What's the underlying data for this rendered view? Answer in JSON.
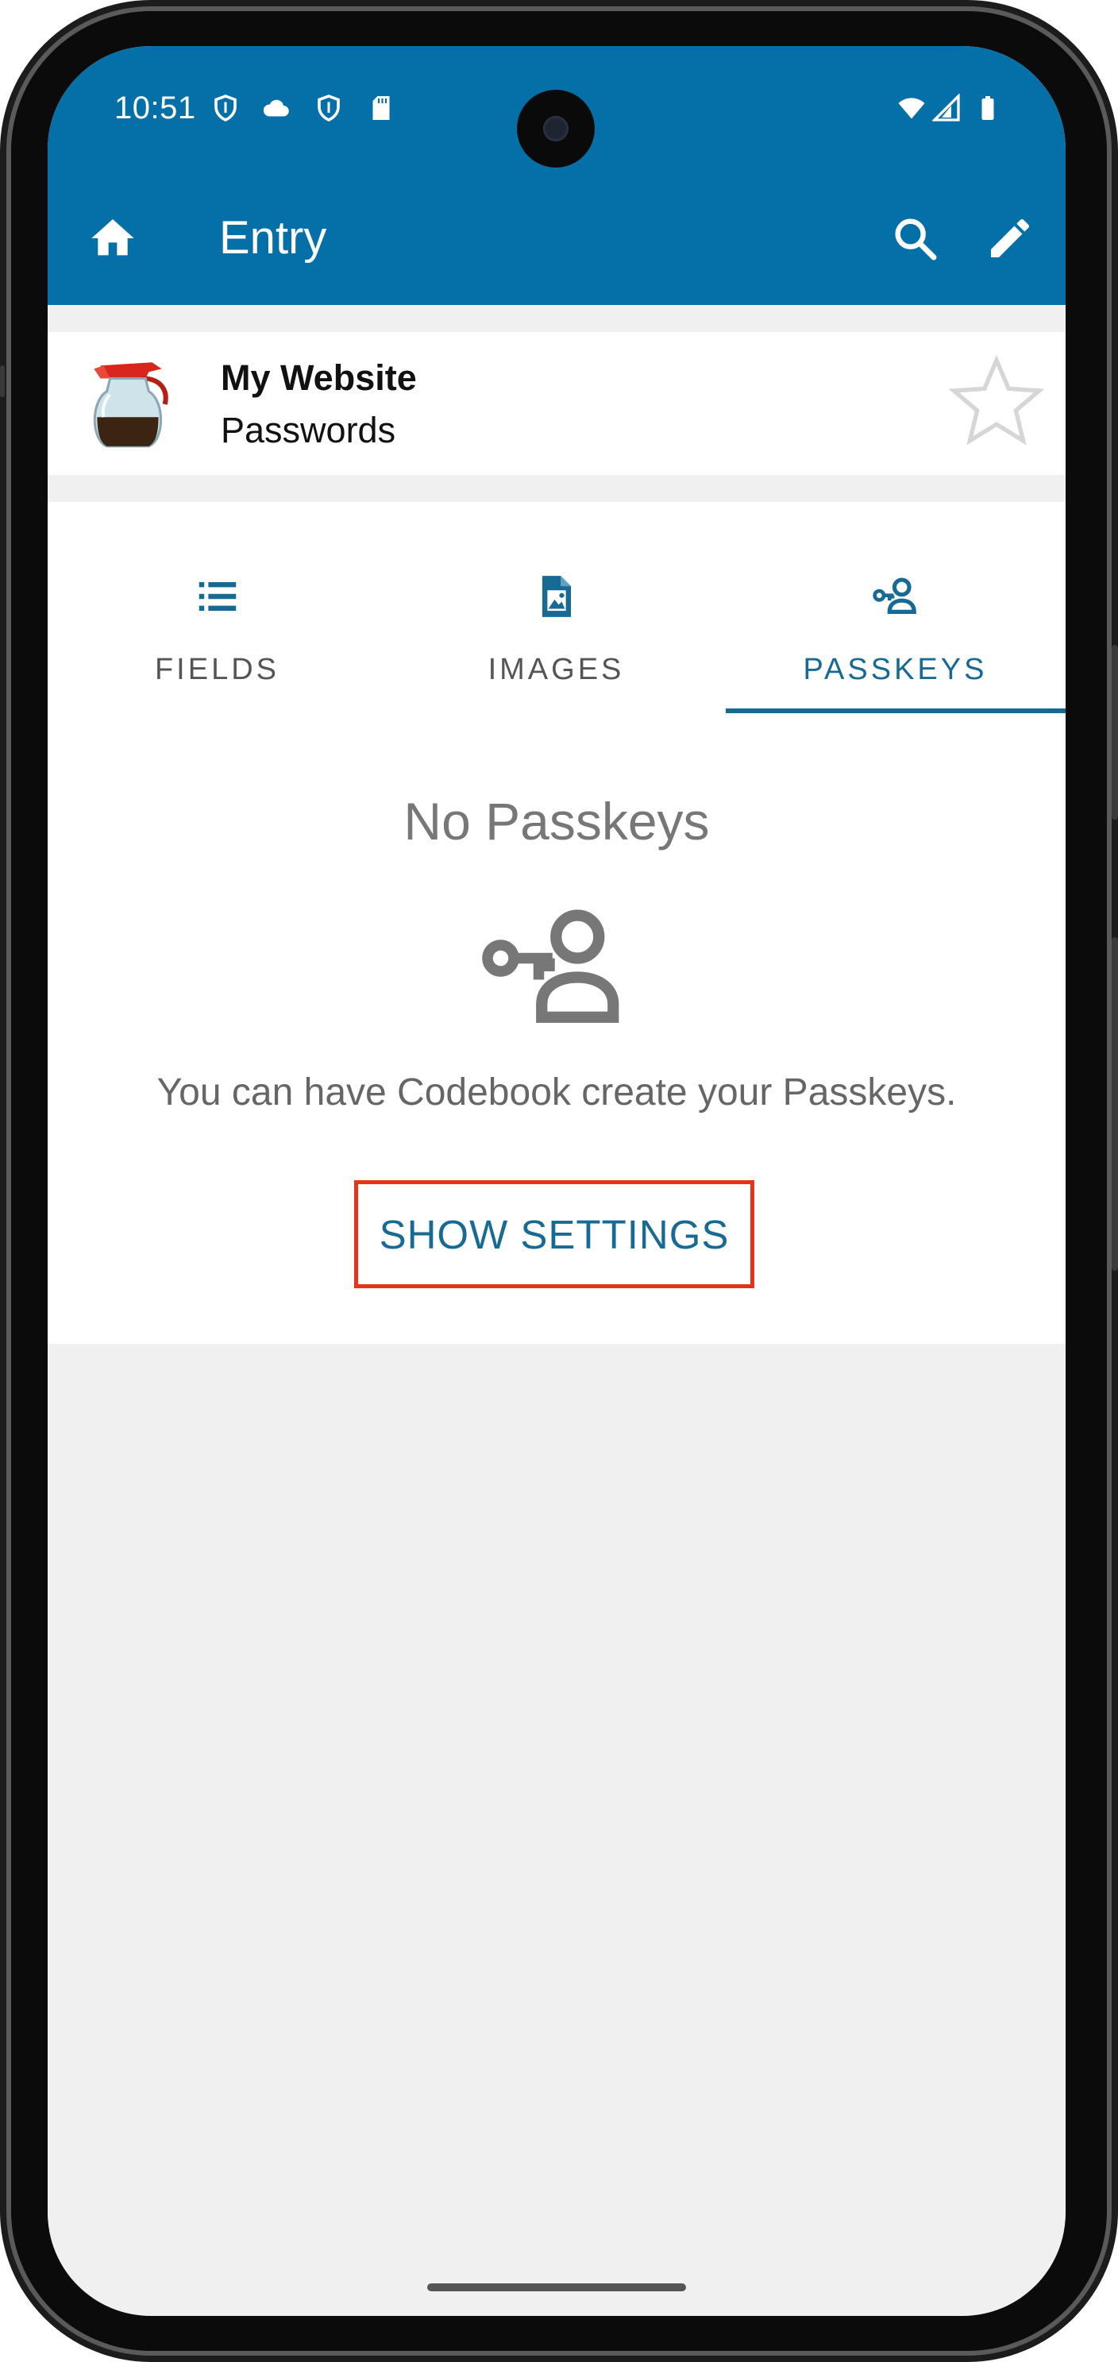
{
  "status_bar": {
    "time": "10:51",
    "left_icons": [
      "shield-icon",
      "cloud-icon",
      "shield-icon",
      "sd-card-icon"
    ],
    "right_icons": [
      "wifi-icon",
      "cell-signal-icon",
      "battery-icon"
    ]
  },
  "app_bar": {
    "title": "Entry",
    "color": "#0570a8",
    "icons": [
      "home-icon",
      "search-icon",
      "edit-icon"
    ]
  },
  "entry": {
    "title": "My Website",
    "subtitle": "Passwords",
    "icon": "coffee-pot-icon",
    "favorite_icon": "star-outline-icon"
  },
  "tabs": [
    {
      "label": "FIELDS",
      "icon": "list-icon",
      "active": false
    },
    {
      "label": "IMAGES",
      "icon": "image-file-icon",
      "active": false
    },
    {
      "label": "PASSKEYS",
      "icon": "passkey-icon",
      "active": true
    }
  ],
  "empty_state": {
    "title": "No Passkeys",
    "icon": "passkey-icon",
    "description": "You can have Codebook create your Passkeys.",
    "button_label": "SHOW SETTINGS",
    "highlight_color": "#e8321a"
  },
  "colors": {
    "accent": "#176a94",
    "background": "#f0f0f0"
  }
}
